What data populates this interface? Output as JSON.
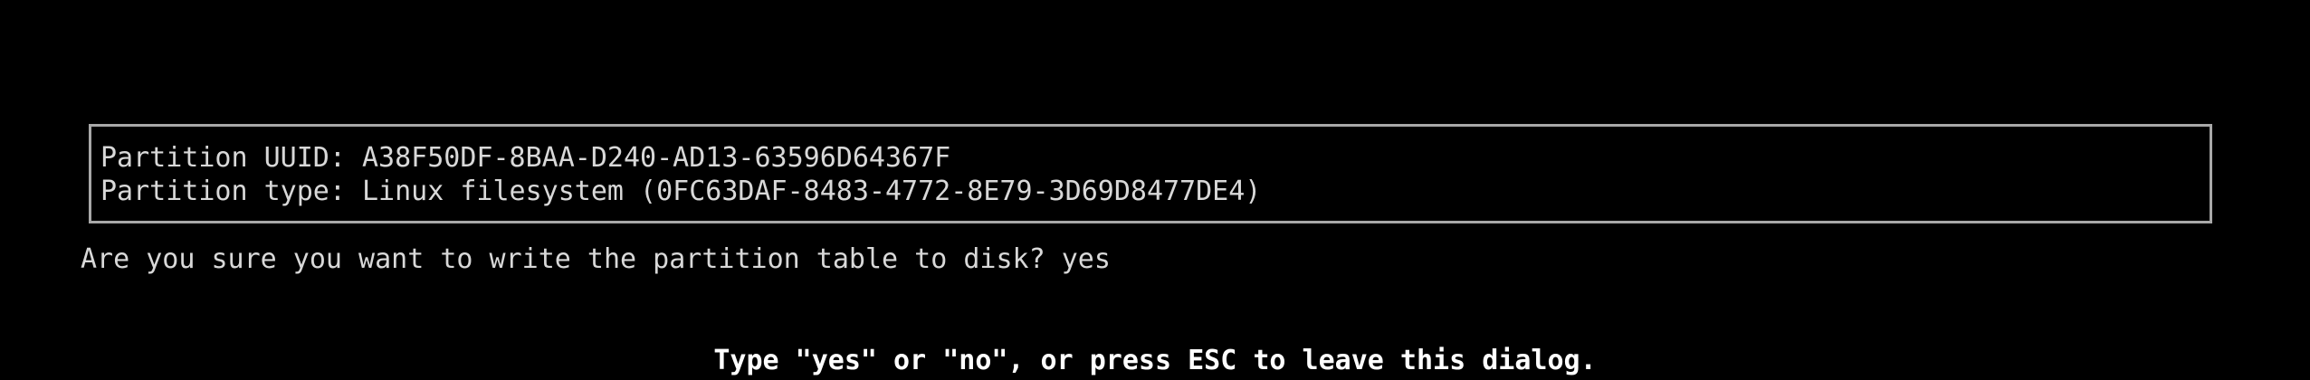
{
  "info_box": {
    "uuid_line": "Partition UUID: A38F50DF-8BAA-D240-AD13-63596D64367F",
    "type_line": "Partition type: Linux filesystem (0FC63DAF-8483-4772-8E79-3D69D8477DE4)"
  },
  "prompt": {
    "question": "Are you sure you want to write the partition table to disk?",
    "answer": "yes"
  },
  "hint": {
    "text": "Type \"yes\" or \"no\", or press ESC to leave this dialog."
  },
  "colors": {
    "background": "#000000",
    "text": "#d8d8d8",
    "border": "#a8a8a8",
    "hint": "#ffffff"
  }
}
